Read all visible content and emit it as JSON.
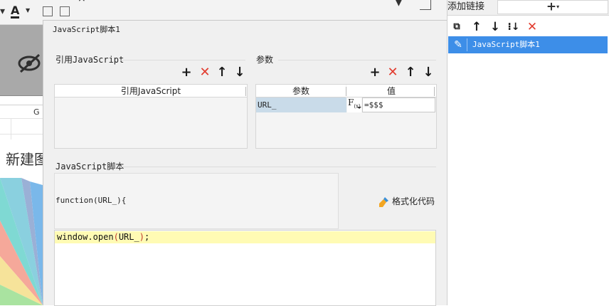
{
  "background": {
    "font_color_letter": "A",
    "column_letter": "G",
    "chart_title_partial": "新建图"
  },
  "dialog": {
    "title": "JavaScript脚本1",
    "ref_section": {
      "label": "引用JavaScript",
      "column_header": "引用JavaScript"
    },
    "params_section": {
      "label": "参数",
      "columns": [
        "参数",
        "值"
      ],
      "rows": [
        {
          "name": "URL_",
          "fx": "F(x)",
          "value": "=$$$"
        }
      ]
    },
    "script_section": {
      "label": "JavaScript脚本",
      "function_header": "function(URL_){",
      "format_button": "格式化代码",
      "code": "window.open(URL_);"
    }
  },
  "right_panel": {
    "title": "添加链接",
    "add_label": "+",
    "links": [
      {
        "label": "JavaScript脚本1",
        "selected": true
      }
    ]
  },
  "colors": {
    "selection_blue": "#3d8ee8",
    "delete_red": "#e23b2e",
    "editor_highlight": "#fffbb4",
    "param_cell": "#c9dbe9"
  }
}
